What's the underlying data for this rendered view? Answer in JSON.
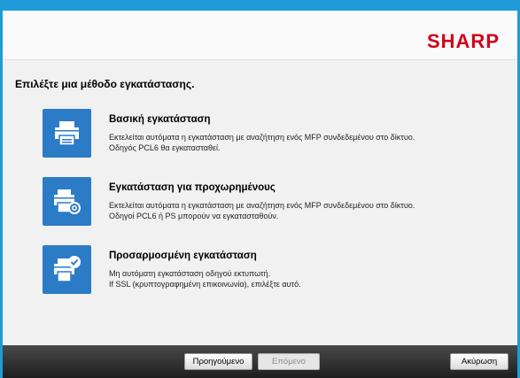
{
  "app": {
    "logo": "SHARP"
  },
  "prompt": "Επιλέξτε μια μέθοδο εγκατάστασης.",
  "options": [
    {
      "title": "Βασική εγκατάσταση",
      "desc": [
        "Εκτελείται αυτόματα η εγκατάσταση με αναζήτηση ενός MFP συνδεδεμένου στο δίκτυο.",
        "Οδηγός PCL6 θα εγκατασταθεί."
      ],
      "icon": "printer-icon"
    },
    {
      "title": "Εγκατάσταση για προχωρημένους",
      "desc": [
        "Εκτελείται αυτόματα η εγκατάσταση με αναζήτηση ενός MFP συνδεδεμένου στο δίκτυο.",
        "Οδηγοί PCL6 ή PS μπορούν να εγκατασταθούν."
      ],
      "icon": "printer-gear-icon"
    },
    {
      "title": "Προσαρμοσμένη εγκατάσταση",
      "desc": [
        "Μη αυτόματη εγκατάσταση οδηγού εκτυπωτή.",
        "If SSL (κρυπτογραφημένη επικοινωνία), επιλέξτε αυτό."
      ],
      "icon": "printer-check-icon"
    }
  ],
  "footer": {
    "back_label": "Προηγούμενο",
    "next_label": "Επόμενο",
    "cancel_label": "Ακύρωση"
  },
  "colors": {
    "accent": "#2c7bc6",
    "titlebar": "#1f9bd8",
    "logo": "#d0021b"
  }
}
